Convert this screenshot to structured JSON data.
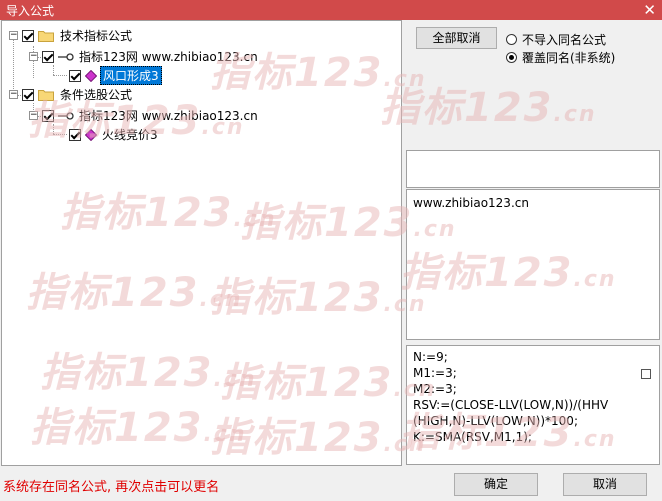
{
  "window": {
    "title": "导入公式",
    "close_glyph": "✕"
  },
  "tree": {
    "nodes": [
      {
        "level": 0,
        "expander": "−",
        "icon": "folder",
        "label": "技术指标公式"
      },
      {
        "level": 1,
        "expander": "−",
        "icon": "link",
        "label": "指标123网 www.zhibiao123.cn"
      },
      {
        "level": 2,
        "expander": "",
        "icon": "diamond",
        "label": "风口形成3",
        "selected": true
      },
      {
        "level": 0,
        "expander": "−",
        "icon": "folder",
        "label": "条件选股公式"
      },
      {
        "level": 1,
        "expander": "−",
        "icon": "link",
        "label": "指标123网 www.zhibiao123.cn"
      },
      {
        "level": 2,
        "expander": "",
        "icon": "diamond",
        "label": "火线竞价3"
      }
    ]
  },
  "right_panel": {
    "cancel_all_label": "全部取消",
    "options": [
      {
        "label": "不导入同名公式",
        "selected": false
      },
      {
        "label": "覆盖同名(非系统)",
        "selected": true
      }
    ],
    "info_text": "www.zhibiao123.cn",
    "code_lines": [
      "N:=9;",
      "M1:=3;",
      "M2:=3;",
      "RSV:=(CLOSE-LLV(LOW,N))/(HHV",
      "(HIGH,N)-LLV(LOW,N))*100;",
      "K:=SMA(RSV,M1,1);"
    ]
  },
  "watermark": {
    "text": "指标123",
    "suffix": ".cn"
  },
  "footer": {
    "status_text": "系统存在同名公式, 再次点击可以更名",
    "ok_label": "确定",
    "cancel_label": "取消"
  },
  "colors": {
    "titlebar": "#d14a4a",
    "status": "#e00000",
    "selection": "#0078d7"
  }
}
